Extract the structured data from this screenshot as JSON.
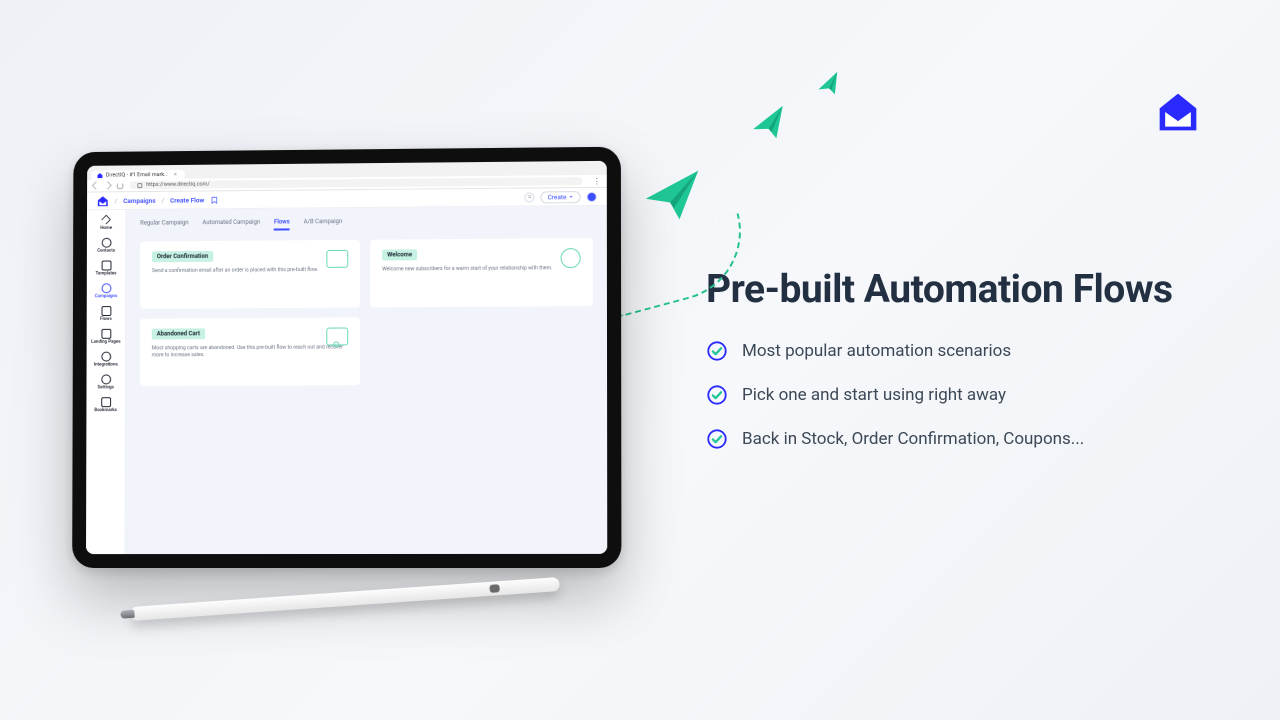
{
  "marketing": {
    "headline": "Pre-built Automation Flows",
    "bullets": [
      "Most popular automation scenarios",
      "Pick one and start using right away",
      "Back in Stock, Order Confirmation, Coupons..."
    ]
  },
  "browser": {
    "tab_title": "DirectIQ - #1 Email mark..",
    "url": "https://www.directiq.com/"
  },
  "app": {
    "breadcrumb": [
      "Campaigns",
      "Create Flow"
    ],
    "create_button": "Create",
    "sidebar": [
      {
        "label": "Home"
      },
      {
        "label": "Contacts"
      },
      {
        "label": "Templates"
      },
      {
        "label": "Campaigns"
      },
      {
        "label": "Flows"
      },
      {
        "label": "Landing Pages"
      },
      {
        "label": "Integrations"
      },
      {
        "label": "Settings"
      },
      {
        "label": "Bookmarks"
      }
    ],
    "subtabs": {
      "items": [
        "Regular Campaign",
        "Automated Campaign",
        "Flows",
        "A/B Campaign"
      ],
      "active": "Flows"
    },
    "cards": [
      {
        "title": "Order Confirmation",
        "desc": "Send a confirmation email after an order is placed with this pre-built flow."
      },
      {
        "title": "Welcome",
        "desc": "Welcome new subscribers for a warm start of your relationship with them."
      },
      {
        "title": "Abandoned Cart",
        "desc": "Most shopping carts are abandoned. Use this pre-built flow to reach out and recover more to increase sales."
      }
    ]
  }
}
